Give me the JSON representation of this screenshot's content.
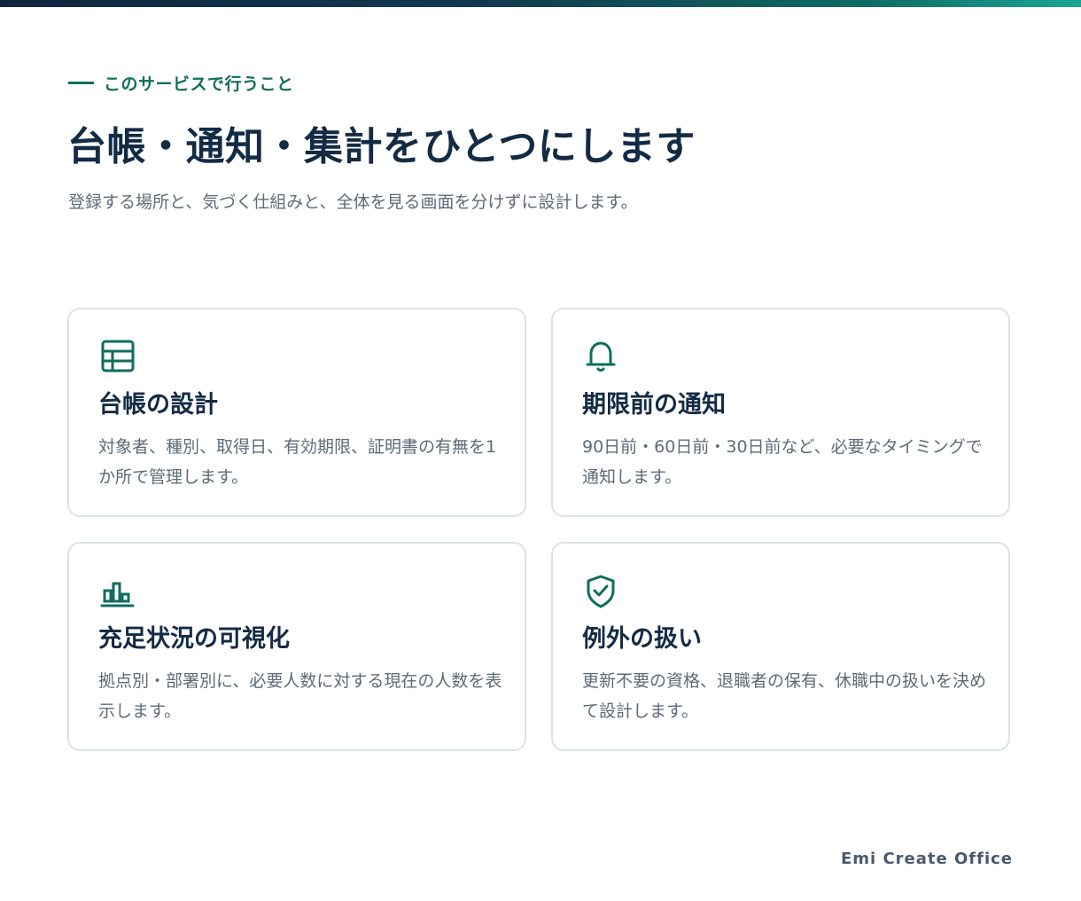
{
  "header": {
    "eyebrow": "このサービスで行うこと",
    "title": "台帳・通知・集計をひとつにします",
    "subtitle": "登録する場所と、気づく仕組みと、全体を見る画面を分けずに設計します。"
  },
  "cards": [
    {
      "icon": "table-icon",
      "title": "台帳の設計",
      "description": "対象者、種別、取得日、有効期限、証明書の有無を1か所で管理します。"
    },
    {
      "icon": "bell-icon",
      "title": "期限前の通知",
      "description": "90日前・60日前・30日前など、必要なタイミングで通知します。"
    },
    {
      "icon": "bar-chart-icon",
      "title": "充足状況の可視化",
      "description": "拠点別・部署別に、必要人数に対する現在の人数を表示します。"
    },
    {
      "icon": "shield-check-icon",
      "title": "例外の扱い",
      "description": "更新不要の資格、退職者の保有、休職中の扱いを決めて設計します。"
    }
  ],
  "footer": {
    "brand": "Emi Create Office"
  },
  "colors": {
    "accent": "#0f6e5c",
    "heading": "#132b45",
    "body_text": "#5d6b79",
    "card_border": "#dde2e6"
  }
}
